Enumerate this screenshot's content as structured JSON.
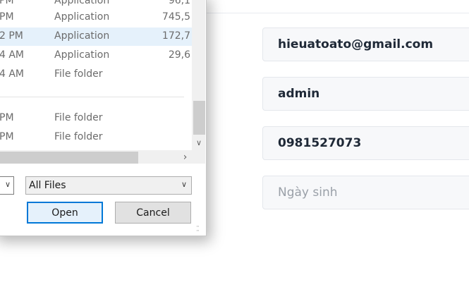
{
  "dialog": {
    "rows": [
      {
        "date": "PM",
        "type": "Application",
        "size": "96,1"
      },
      {
        "date": "PM",
        "type": "Application",
        "size": "745,5"
      },
      {
        "date": "2 PM",
        "type": "Application",
        "size": "172,7"
      },
      {
        "date": "4 AM",
        "type": "Application",
        "size": "29,6"
      },
      {
        "date": "4 AM",
        "type": "File folder",
        "size": ""
      },
      {
        "date": "PM",
        "type": "File folder",
        "size": ""
      },
      {
        "date": "PM",
        "type": "File folder",
        "size": ""
      }
    ],
    "filter_value": "All Files",
    "open_label": "Open",
    "cancel_label": "Cancel"
  },
  "form": {
    "email": "hieuatoato@gmail.com",
    "username": "admin",
    "phone": "0981527073",
    "dob_placeholder": "Ngày sinh"
  },
  "icons": {
    "scroll_down": "chevron-down-icon",
    "scroll_right": "chevron-right-icon",
    "dropdown": "chevron-down-icon",
    "resize_grip": "resize-grip-icon"
  },
  "colors": {
    "selection": "#e5f1fb",
    "primary_button_border": "#0078d7",
    "field_background": "#f7f8fa"
  }
}
